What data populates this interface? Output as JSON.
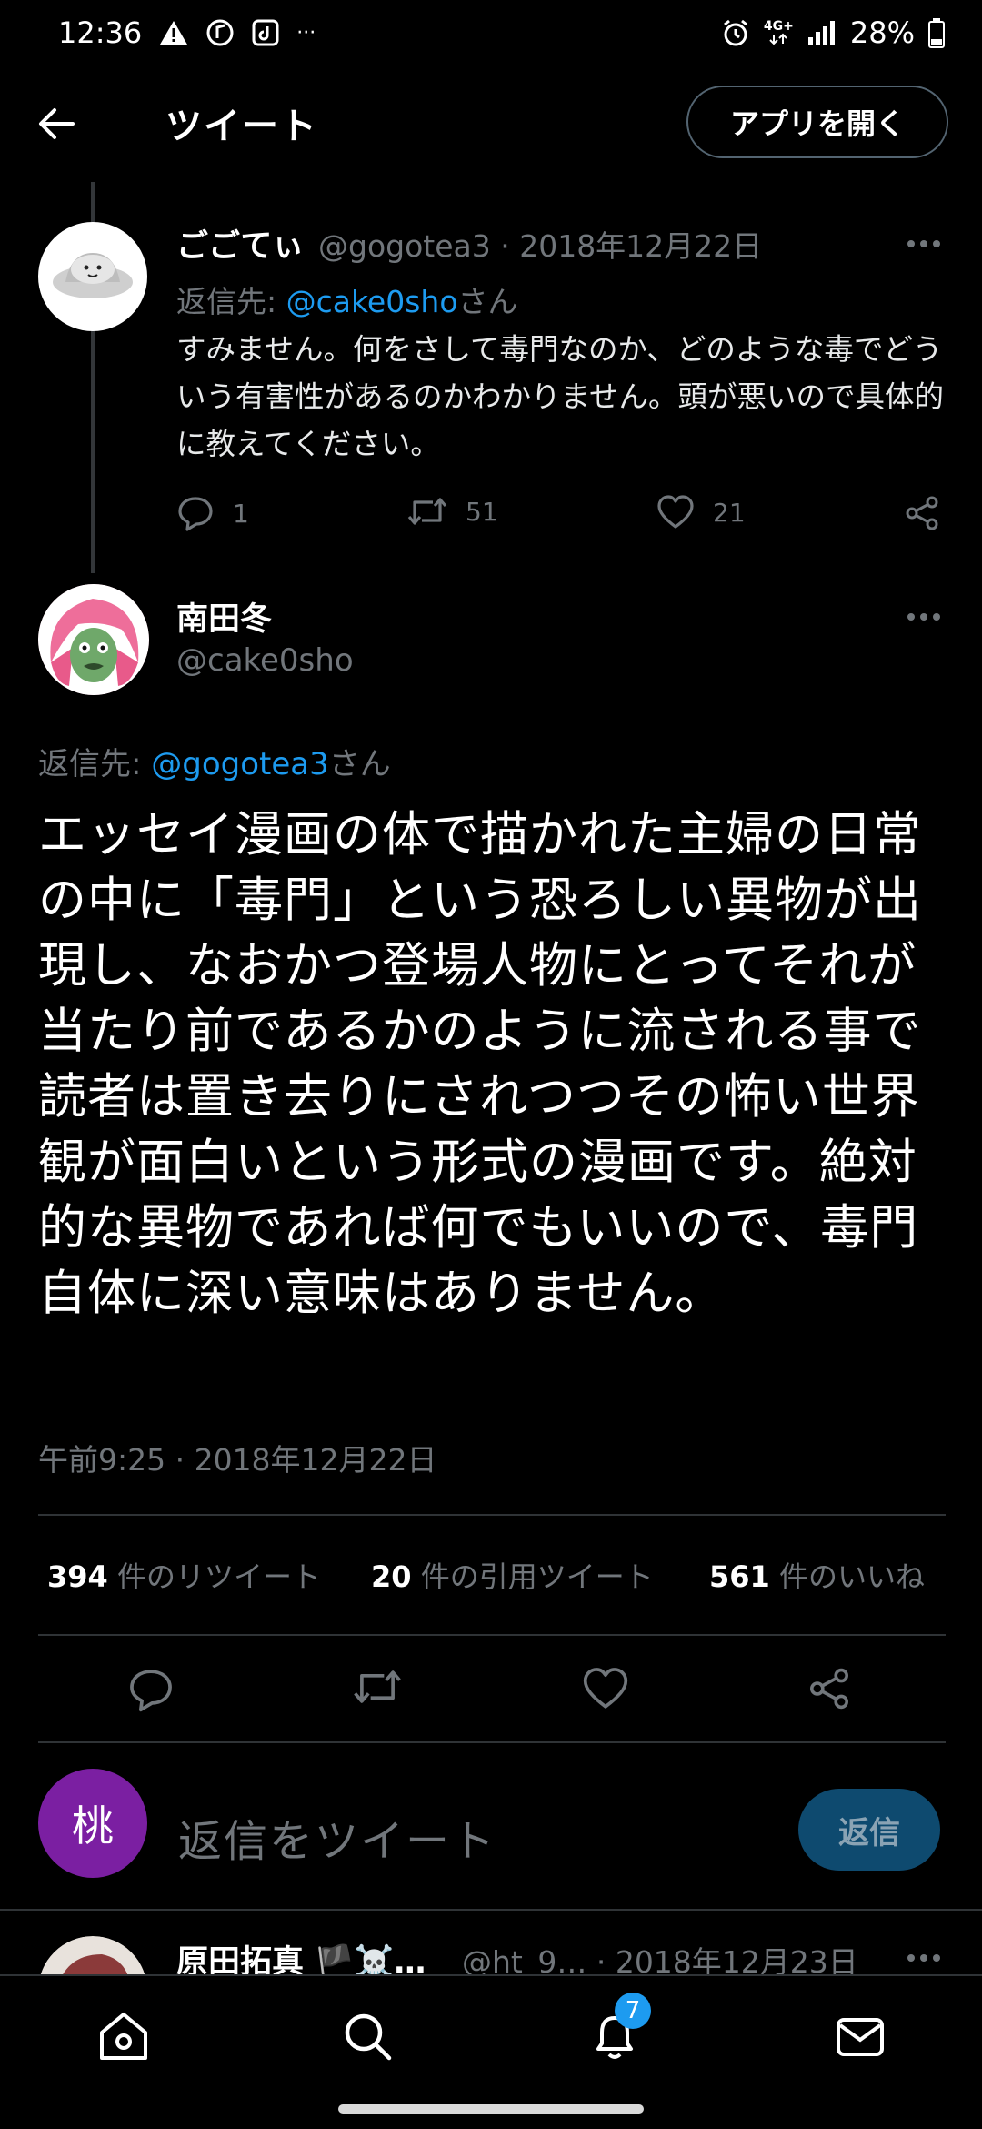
{
  "status_bar": {
    "time": "12:36",
    "overflow": "···",
    "network": "4G+",
    "battery": "28%"
  },
  "header": {
    "title": "ツイート",
    "open_app": "アプリを開く"
  },
  "parent_tweet": {
    "name": "ごごてぃ",
    "meta": "@gogotea3 · 2018年12月22日",
    "reply_prefix": "返信先: ",
    "reply_handle": "@cake0sho",
    "reply_suffix": "さん",
    "text": "すみません。何をさして毒門なのか、どのような毒でどういう有害性があるのかわかりません。頭が悪いので具体的に教えてください。",
    "replies": "1",
    "retweets": "51",
    "likes": "21"
  },
  "main_tweet": {
    "name": "南田冬",
    "handle": "@cake0sho",
    "reply_prefix": "返信先: ",
    "reply_handle": "@gogotea3",
    "reply_suffix": "さん",
    "text": "エッセイ漫画の体で描かれた主婦の日常の中に「毒門」という恐ろしい異物が出現し、なおかつ登場人物にとってそれが当たり前であるかのように流される事で読者は置き去りにされつつその怖い世界観が面白いという形式の漫画です。絶対的な異物であれば何でもいいので、毒門自体に深い意味はありません。",
    "timestamp": "午前9:25 · 2018年12月22日",
    "retweets_count": "394",
    "retweets_label": " 件のリツイート",
    "quotes_count": "20",
    "quotes_label": " 件の引用ツイート",
    "likes_count": "561",
    "likes_label": " 件のいいね"
  },
  "compose": {
    "avatar_char": "桃",
    "placeholder": "返信をツイート",
    "reply_button": "返信"
  },
  "next_tweet": {
    "name": "原田拓真 🏴☠️…",
    "meta": "@ht_9… · 2018年12月23日"
  },
  "bottom_nav": {
    "items": [
      "home-icon",
      "search-icon",
      "bell-icon",
      "mail-icon"
    ],
    "notification_badge": "7"
  },
  "colors": {
    "accent": "#1d9bf0",
    "background": "#000000",
    "secondary_text": "#71767b"
  }
}
